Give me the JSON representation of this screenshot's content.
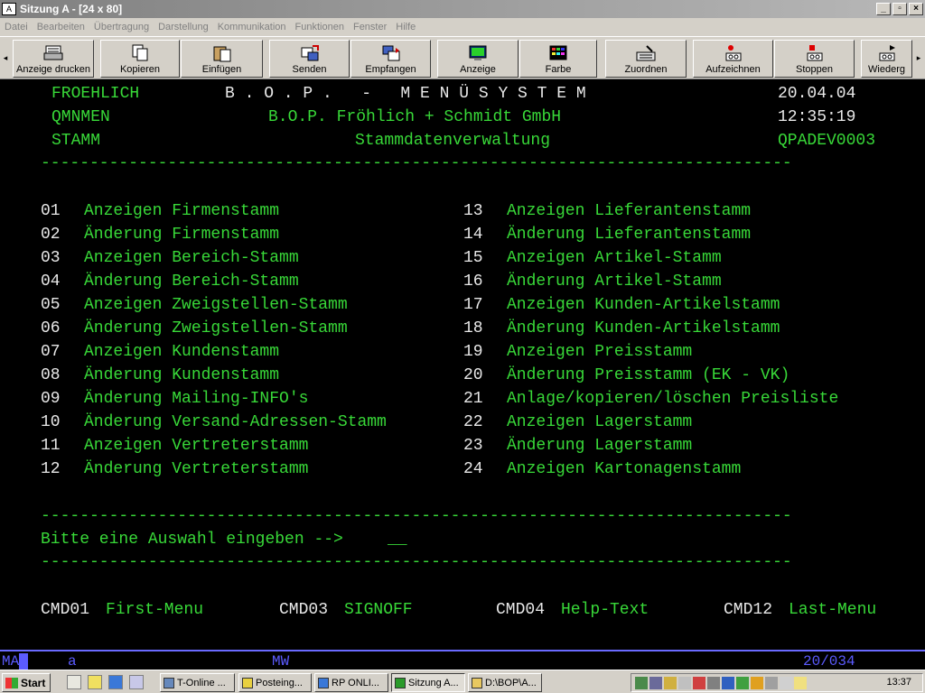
{
  "window": {
    "title": "Sitzung A - [24 x 80]",
    "controls": [
      "_",
      "▫",
      "×"
    ]
  },
  "menubar": [
    "Datei",
    "Bearbeiten",
    "Übertragung",
    "Darstellung",
    "Kommunikation",
    "Funktionen",
    "Fenster",
    "Hilfe"
  ],
  "toolbar": {
    "buttons": [
      {
        "label": "Anzeige drucken",
        "icon": "printer-icon"
      },
      {
        "label": "Kopieren",
        "icon": "copy-icon"
      },
      {
        "label": "Einfügen",
        "icon": "paste-icon"
      },
      {
        "label": "Senden",
        "icon": "send-icon"
      },
      {
        "label": "Empfangen",
        "icon": "receive-icon"
      },
      {
        "label": "Anzeige",
        "icon": "display-icon"
      },
      {
        "label": "Farbe",
        "icon": "color-icon"
      },
      {
        "label": "Zuordnen",
        "icon": "keyboard-map-icon"
      },
      {
        "label": "Aufzeichnen",
        "icon": "record-icon"
      },
      {
        "label": "Stoppen",
        "icon": "stop-icon"
      },
      {
        "label": "Wiederg",
        "icon": "play-icon"
      }
    ]
  },
  "terminal": {
    "header": {
      "user": "FROEHLICH",
      "system_title": "B . O . P .   -   M E N Ü S Y S T E M",
      "date": "20.04.04",
      "program": "QMNMEN",
      "company": "B.O.P. Fröhlich + Schmidt GmbH",
      "time": "12:35:19",
      "menu": "STAMM",
      "subtitle": "Stammdatenverwaltung",
      "device": "QPADEV0003"
    },
    "separator": "-----------------------------------------------------------------------------",
    "options_left": [
      {
        "num": "01",
        "text": "Anzeigen Firmenstamm"
      },
      {
        "num": "02",
        "text": "Änderung Firmenstamm"
      },
      {
        "num": "03",
        "text": "Anzeigen Bereich-Stamm"
      },
      {
        "num": "04",
        "text": "Änderung Bereich-Stamm"
      },
      {
        "num": "05",
        "text": "Anzeigen Zweigstellen-Stamm"
      },
      {
        "num": "06",
        "text": "Änderung Zweigstellen-Stamm"
      },
      {
        "num": "07",
        "text": "Anzeigen Kundenstamm"
      },
      {
        "num": "08",
        "text": "Änderung Kundenstamm"
      },
      {
        "num": "09",
        "text": "Änderung Mailing-INFO's"
      },
      {
        "num": "10",
        "text": "Änderung Versand-Adressen-Stamm"
      },
      {
        "num": "11",
        "text": "Anzeigen Vertreterstamm"
      },
      {
        "num": "12",
        "text": "Änderung Vertreterstamm"
      }
    ],
    "options_right": [
      {
        "num": "13",
        "text": "Anzeigen Lieferantenstamm"
      },
      {
        "num": "14",
        "text": "Änderung Lieferantenstamm"
      },
      {
        "num": "15",
        "text": "Anzeigen Artikel-Stamm"
      },
      {
        "num": "16",
        "text": "Änderung Artikel-Stamm"
      },
      {
        "num": "17",
        "text": "Anzeigen Kunden-Artikelstamm"
      },
      {
        "num": "18",
        "text": "Änderung Kunden-Artikelstamm"
      },
      {
        "num": "19",
        "text": "Anzeigen Preisstamm"
      },
      {
        "num": "20",
        "text": "Änderung Preisstamm (EK - VK)"
      },
      {
        "num": "21",
        "text": "Anlage/kopieren/löschen Preisliste"
      },
      {
        "num": "22",
        "text": "Anzeigen Lagerstamm"
      },
      {
        "num": "23",
        "text": "Änderung Lagerstamm"
      },
      {
        "num": "24",
        "text": "Anzeigen Kartonagenstamm"
      }
    ],
    "prompt": "Bitte eine Auswahl eingeben -->",
    "input_value": "__",
    "commands": [
      {
        "key": "CMD01",
        "label": "First-Menu"
      },
      {
        "key": "CMD03",
        "label": "SIGNOFF"
      },
      {
        "key": "CMD04",
        "label": "Help-Text"
      },
      {
        "key": "CMD12",
        "label": "Last-Menu"
      }
    ]
  },
  "statusbar": {
    "mode": "MA",
    "indicator_a": "a",
    "indicator_mw": "MW",
    "cursor_pos": "20/034"
  },
  "taskbar": {
    "start_label": "Start",
    "tasks": [
      {
        "label": "T-Online ..."
      },
      {
        "label": "Posteing..."
      },
      {
        "label": "RP ONLI..."
      },
      {
        "label": "Sitzung A..."
      },
      {
        "label": "D:\\BOP\\A..."
      }
    ],
    "clock": "13:37"
  },
  "colors": {
    "terminal_green": "#38d838",
    "terminal_white": "#e8e8e8",
    "status_blue": "#5b5bff",
    "terminal_bg": "#000000"
  }
}
